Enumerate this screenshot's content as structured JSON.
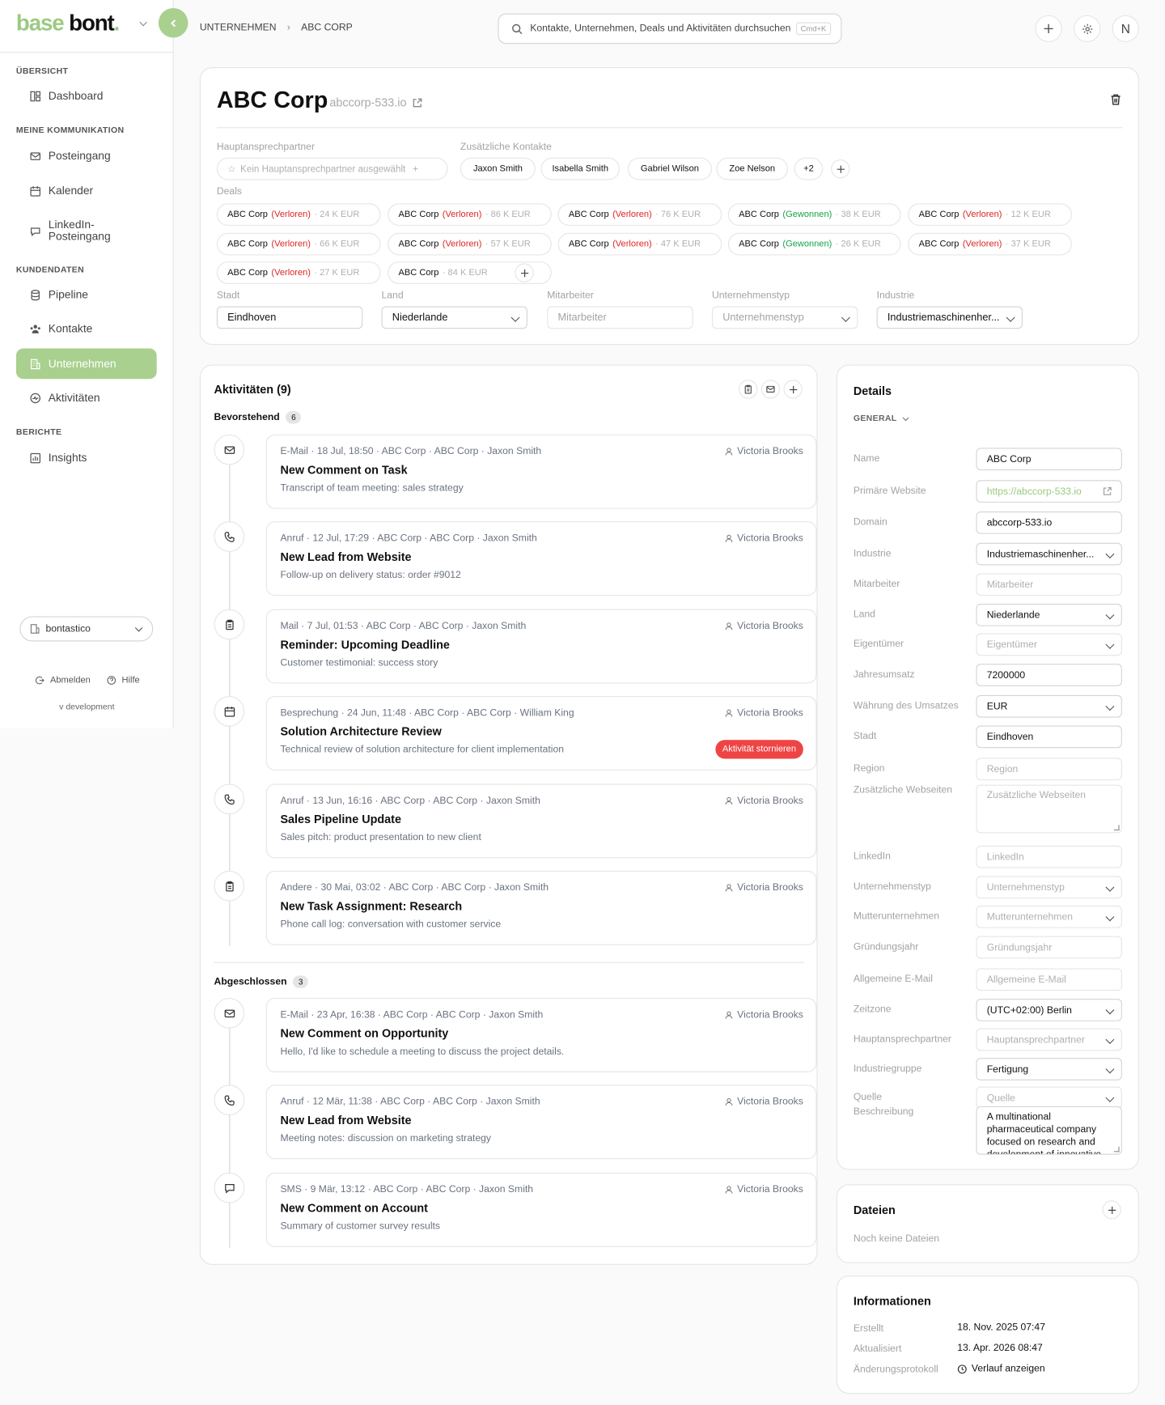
{
  "brand": {
    "base": "base",
    "bont": "bont",
    "dot": "."
  },
  "breadcrumb": {
    "parent": "UNTERNEHMEN",
    "current": "ABC CORP"
  },
  "search": {
    "placeholder": "Kontakte, Unternehmen, Deals und Aktivitäten durchsuchen",
    "shortcut": "Cmd+K"
  },
  "user": {
    "initial": "N"
  },
  "sidebar": {
    "sections": [
      {
        "label": "ÜBERSICHT",
        "items": [
          {
            "label": "Dashboard"
          }
        ]
      },
      {
        "label": "MEINE KOMMUNIKATION",
        "items": [
          {
            "label": "Posteingang"
          },
          {
            "label": "Kalender"
          },
          {
            "label": "LinkedIn-",
            "label2": "Posteingang"
          }
        ]
      },
      {
        "label": "KUNDENDATEN",
        "items": [
          {
            "label": "Pipeline"
          },
          {
            "label": "Kontakte"
          },
          {
            "label": "Unternehmen"
          },
          {
            "label": "Aktivitäten"
          }
        ]
      },
      {
        "label": "BERICHTE",
        "items": [
          {
            "label": "Insights"
          }
        ]
      }
    ],
    "workspace": "bontastico",
    "logout": "Abmelden",
    "help": "Hilfe",
    "version": "v development"
  },
  "company": {
    "name": "ABC Corp",
    "domain": "abccorp-533.io",
    "primary_contact_label": "Hauptansprechpartner",
    "primary_contact_placeholder": "Kein Hauptansprechpartner ausgewählt",
    "extra_contacts_label": "Zusätzliche Kontakte",
    "contacts": [
      "Jaxon Smith",
      "Isabella Smith",
      "Gabriel Wilson",
      "Zoe Nelson"
    ],
    "contacts_more": "+2",
    "deals_label": "Deals",
    "deals": [
      {
        "name": "ABC Corp",
        "status": "(Verloren)",
        "amount": "· 24 K EUR"
      },
      {
        "name": "ABC Corp",
        "status": "(Verloren)",
        "amount": "· 86 K EUR"
      },
      {
        "name": "ABC Corp",
        "status": "(Verloren)",
        "amount": "· 76 K EUR"
      },
      {
        "name": "ABC Corp",
        "status": "(Gewonnen)",
        "amount": "· 38 K EUR"
      },
      {
        "name": "ABC Corp",
        "status": "(Verloren)",
        "amount": "· 12 K EUR"
      },
      {
        "name": "ABC Corp",
        "status": "(Verloren)",
        "amount": "· 66 K EUR"
      },
      {
        "name": "ABC Corp",
        "status": "(Verloren)",
        "amount": "· 57 K EUR"
      },
      {
        "name": "ABC Corp",
        "status": "(Verloren)",
        "amount": "· 47 K EUR"
      },
      {
        "name": "ABC Corp",
        "status": "(Gewonnen)",
        "amount": "· 26 K EUR"
      },
      {
        "name": "ABC Corp",
        "status": "(Verloren)",
        "amount": "· 37 K EUR"
      },
      {
        "name": "ABC Corp",
        "status": "(Verloren)",
        "amount": "· 27 K EUR"
      },
      {
        "name": "ABC Corp",
        "status": "",
        "amount": "· 84 K EUR"
      }
    ],
    "fields": [
      {
        "label": "Stadt",
        "value": "Eindhoven",
        "placeholder": "",
        "select": false
      },
      {
        "label": "Land",
        "value": "Niederlande",
        "placeholder": "",
        "select": true
      },
      {
        "label": "Mitarbeiter",
        "value": "",
        "placeholder": "Mitarbeiter",
        "select": false
      },
      {
        "label": "Unternehmenstyp",
        "value": "",
        "placeholder": "Unternehmenstyp",
        "select": true
      },
      {
        "label": "Industrie",
        "value": "Industriemaschinenher...",
        "placeholder": "",
        "select": true
      }
    ]
  },
  "activities": {
    "title": "Aktivitäten (9)",
    "upcoming_label": "Bevorstehend",
    "upcoming_count": "6",
    "done_label": "Abgeschlossen",
    "done_count": "3",
    "cancel_label": "Aktivität stornieren",
    "items": [
      {
        "icon": "mail-icon",
        "meta": "E-Mail  ·  18 Jul, 18:50  ·  ABC Corp  ·  ABC Corp  ·  Jaxon Smith",
        "owner": "Victoria Brooks",
        "title": "New Comment on Task",
        "desc": "Transcript of team meeting: sales strategy"
      },
      {
        "icon": "phone-icon",
        "meta": "Anruf  ·  12 Jul, 17:29  ·  ABC Corp  ·  ABC Corp  ·  Jaxon Smith",
        "owner": "Victoria Brooks",
        "title": "New Lead from Website",
        "desc": "Follow-up on delivery status: order #9012"
      },
      {
        "icon": "clipboard-icon",
        "meta": "Mail  ·  7 Jul, 01:53  ·  ABC Corp  ·  ABC Corp  ·  Jaxon Smith",
        "owner": "Victoria Brooks",
        "title": "Reminder: Upcoming Deadline",
        "desc": "Customer testimonial: success story"
      },
      {
        "icon": "calendar-icon",
        "meta": "Besprechung  ·  24 Jun, 11:48  ·  ABC Corp  ·  ABC Corp  ·  William King",
        "owner": "Victoria Brooks",
        "title": "Solution Architecture Review",
        "desc": "Technical review of solution architecture for client implementation"
      },
      {
        "icon": "phone-icon",
        "meta": "Anruf  ·  13 Jun, 16:16  ·  ABC Corp  ·  ABC Corp  ·  Jaxon Smith",
        "owner": "Victoria Brooks",
        "title": "Sales Pipeline Update",
        "desc": "Sales pitch: product presentation to new client"
      },
      {
        "icon": "clipboard-icon",
        "meta": "Andere  ·  30 Mai, 03:02  ·  ABC Corp  ·  ABC Corp  ·  Jaxon Smith",
        "owner": "Victoria Brooks",
        "title": "New Task Assignment: Research",
        "desc": "Phone call log: conversation with customer service"
      },
      {
        "icon": "mail-icon",
        "meta": "E-Mail  ·  23 Apr, 16:38  ·  ABC Corp  ·  ABC Corp  ·  Jaxon Smith",
        "owner": "Victoria Brooks",
        "title": "New Comment on Opportunity",
        "desc": "Hello, I'd like to schedule a meeting to discuss the project details."
      },
      {
        "icon": "phone-icon",
        "meta": "Anruf  ·  12 Mär, 11:38  ·  ABC Corp  ·  ABC Corp  ·  Jaxon Smith",
        "owner": "Victoria Brooks",
        "title": "New Lead from Website",
        "desc": "Meeting notes: discussion on marketing strategy"
      },
      {
        "icon": "chat-icon",
        "meta": "SMS  ·  9 Mär, 13:12  ·  ABC Corp  ·  ABC Corp  ·  Jaxon Smith",
        "owner": "Victoria Brooks",
        "title": "New Comment on Account",
        "desc": "Summary of customer survey results"
      }
    ]
  },
  "details": {
    "title": "Details",
    "group": "GENERAL",
    "rows": [
      {
        "label": "Name",
        "value": "ABC Corp",
        "placeholder": ""
      },
      {
        "label": "Primäre Website",
        "value": "https://abccorp-533.io",
        "placeholder": ""
      },
      {
        "label": "Domain",
        "value": "abccorp-533.io",
        "placeholder": ""
      },
      {
        "label": "Industrie",
        "value": "Industriemaschinenher...",
        "placeholder": ""
      },
      {
        "label": "Mitarbeiter",
        "value": "",
        "placeholder": "Mitarbeiter"
      },
      {
        "label": "Land",
        "value": "Niederlande",
        "placeholder": ""
      },
      {
        "label": "Eigentümer",
        "value": "",
        "placeholder": "Eigentümer"
      },
      {
        "label": "Jahresumsatz",
        "value": "7200000",
        "placeholder": ""
      },
      {
        "label": "Währung des Umsatzes",
        "value": "EUR",
        "placeholder": ""
      },
      {
        "label": "Stadt",
        "value": "Eindhoven",
        "placeholder": ""
      },
      {
        "label": "Region",
        "value": "",
        "placeholder": "Region"
      },
      {
        "label": "Zusätzliche Webseiten",
        "value": "",
        "placeholder": "Zusätzliche Webseiten"
      },
      {
        "label": "LinkedIn",
        "value": "",
        "placeholder": "LinkedIn"
      },
      {
        "label": "Unternehmenstyp",
        "value": "",
        "placeholder": "Unternehmenstyp"
      },
      {
        "label": "Mutterunternehmen",
        "value": "",
        "placeholder": "Mutterunternehmen"
      },
      {
        "label": "Gründungsjahr",
        "value": "",
        "placeholder": "Gründungsjahr"
      },
      {
        "label": "Allgemeine E-Mail",
        "value": "",
        "placeholder": "Allgemeine E-Mail"
      },
      {
        "label": "Zeitzone",
        "value": "(UTC+02:00) Berlin",
        "placeholder": ""
      },
      {
        "label": "Hauptansprechpartner",
        "value": "",
        "placeholder": "Hauptansprechpartner"
      },
      {
        "label": "Industriegruppe",
        "value": "Fertigung",
        "placeholder": ""
      },
      {
        "label": "Quelle",
        "value": "",
        "placeholder": "Quelle"
      },
      {
        "label": "Beschreibung",
        "value": "A multinational pharmaceutical company focused on research and development of innovative",
        "placeholder": ""
      }
    ]
  },
  "files": {
    "title": "Dateien",
    "empty": "Noch keine Dateien"
  },
  "info": {
    "title": "Informationen",
    "created_label": "Erstellt",
    "created": "18. Nov. 2025 07:47",
    "updated_label": "Aktualisiert",
    "updated": "13. Apr. 2026 08:47",
    "log_label": "Änderungsprotokoll",
    "log_link": "Verlauf anzeigen"
  },
  "colors": {
    "brand_green": "#9cc982",
    "active_bg": "#a9d08e",
    "lost": "#dc2626",
    "won": "#16a34a",
    "cancel": "#ef4444"
  }
}
